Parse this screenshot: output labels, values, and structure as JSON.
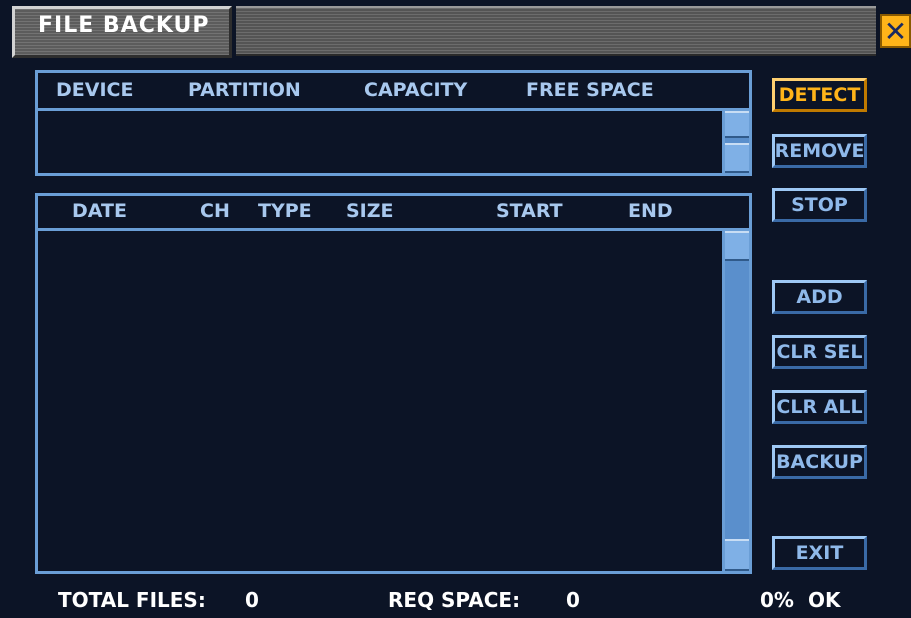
{
  "window": {
    "title": "FILE BACKUP",
    "close_icon": "close-icon"
  },
  "device_table": {
    "columns": [
      "DEVICE",
      "PARTITION",
      "CAPACITY",
      "FREE SPACE"
    ],
    "rows": []
  },
  "file_table": {
    "columns": [
      "DATE",
      "CH",
      "TYPE",
      "SIZE",
      "START",
      "END"
    ],
    "rows": []
  },
  "buttons": {
    "detect": "DETECT",
    "remove": "REMOVE",
    "stop": "STOP",
    "add": "ADD",
    "clr_sel": "CLR SEL",
    "clr_all": "CLR ALL",
    "backup": "BACKUP",
    "exit": "EXIT"
  },
  "status": {
    "total_files_label": "TOTAL FILES:",
    "total_files_value": "0",
    "req_space_label": "REQ SPACE:",
    "req_space_value": "0",
    "progress": "0%",
    "state": "OK"
  },
  "colors": {
    "background": "#0c1426",
    "accent": "#ffb419",
    "border": "#6a9ed6",
    "header_text": "#a8c8ee"
  }
}
